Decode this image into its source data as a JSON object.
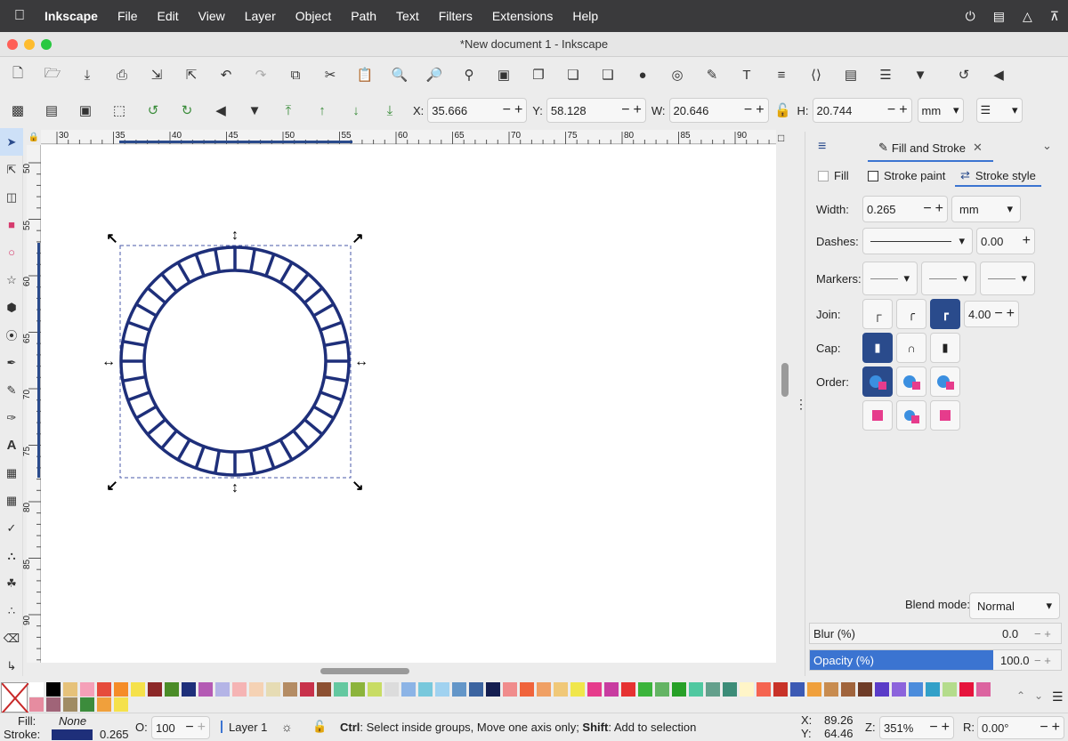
{
  "menubar": {
    "app": "Inkscape",
    "items": [
      "File",
      "Edit",
      "View",
      "Layer",
      "Object",
      "Path",
      "Text",
      "Filters",
      "Extensions",
      "Help"
    ]
  },
  "window": {
    "title": "*New document 1 - Inkscape"
  },
  "toolbar2": {
    "x_label": "X:",
    "x": "35.666",
    "y_label": "Y:",
    "y": "58.128",
    "w_label": "W:",
    "w": "20.646",
    "h_label": "H:",
    "h": "20.744",
    "unit": "mm"
  },
  "ruler": {
    "h_ticks": [
      "30",
      "35",
      "40",
      "45",
      "50",
      "55",
      "60",
      "65",
      "70",
      "75",
      "80",
      "85",
      "90"
    ],
    "v_ticks": [
      "50",
      "55",
      "60",
      "65",
      "70",
      "75",
      "80",
      "85",
      "90"
    ]
  },
  "panel": {
    "tab_label": "Fill and Stroke",
    "sub_tabs": [
      "Fill",
      "Stroke paint",
      "Stroke style"
    ],
    "width_label": "Width:",
    "width": "0.265",
    "width_unit": "mm",
    "dashes_label": "Dashes:",
    "dash_offset": "0.00",
    "markers_label": "Markers:",
    "join_label": "Join:",
    "miter": "4.00",
    "cap_label": "Cap:",
    "order_label": "Order:",
    "blend_label": "Blend mode:",
    "blend": "Normal",
    "blur_label": "Blur (%)",
    "blur": "0.0",
    "opacity_label": "Opacity (%)",
    "opacity": "100.0"
  },
  "status": {
    "fill_label": "Fill:",
    "fill_value": "None",
    "stroke_label": "Stroke:",
    "stroke_width": "0.265",
    "o_label": "O:",
    "opacity": "100",
    "layer": "Layer 1",
    "hint_ctrl": "Ctrl",
    "hint_1": ": Select inside groups, Move one axis only; ",
    "hint_shift": "Shift",
    "hint_2": ": Add to selection",
    "cx_label": "X:",
    "cx": "89.26",
    "cy_label": "Y:",
    "cy": "64.46",
    "zoom_label": "Z:",
    "zoom": "351%",
    "rot_label": "R:",
    "rotation": "0.00°"
  },
  "colors": {
    "accent": "#2a4b8c",
    "stroke": "#1e2f7a",
    "selected_row": "#3b74d1"
  },
  "palette": [
    "#ffffff",
    "#000000",
    "#e6c27a",
    "#f5a0b8",
    "#e64b3c",
    "#f58c28",
    "#f5e14b",
    "#8c2828",
    "#4b8c28",
    "#1e2f7a",
    "#b45ab4",
    "#b4b4e6",
    "#f5b4b4",
    "#f5d2b4",
    "#e6dcb4",
    "#b48c64",
    "#c8324b",
    "#8c5032",
    "#64c8a0",
    "#8cb43c",
    "#c8dc64",
    "#dcdcdc",
    "#8cb4e6",
    "#78c8dc",
    "#a0d2f0",
    "#6496c8",
    "#3c64a0",
    "#141e50",
    "#f08c8c",
    "#f0643c",
    "#f0a064",
    "#f0c878",
    "#f0e64b",
    "#e63c8c",
    "#c83ca0",
    "#e63232",
    "#3cb43c",
    "#64b464",
    "#28a028",
    "#50c8a0",
    "#64a08c",
    "#3c8c78",
    "#fff5c8",
    "#f56450",
    "#c83228",
    "#3c5ab4",
    "#f0a03c",
    "#c88c50",
    "#a0643c",
    "#6e3c28",
    "#5a3cc8",
    "#8c64dc",
    "#4b8cdc",
    "#32a0c8",
    "#b4dc8c",
    "#e6143c",
    "#dc64a0"
  ]
}
